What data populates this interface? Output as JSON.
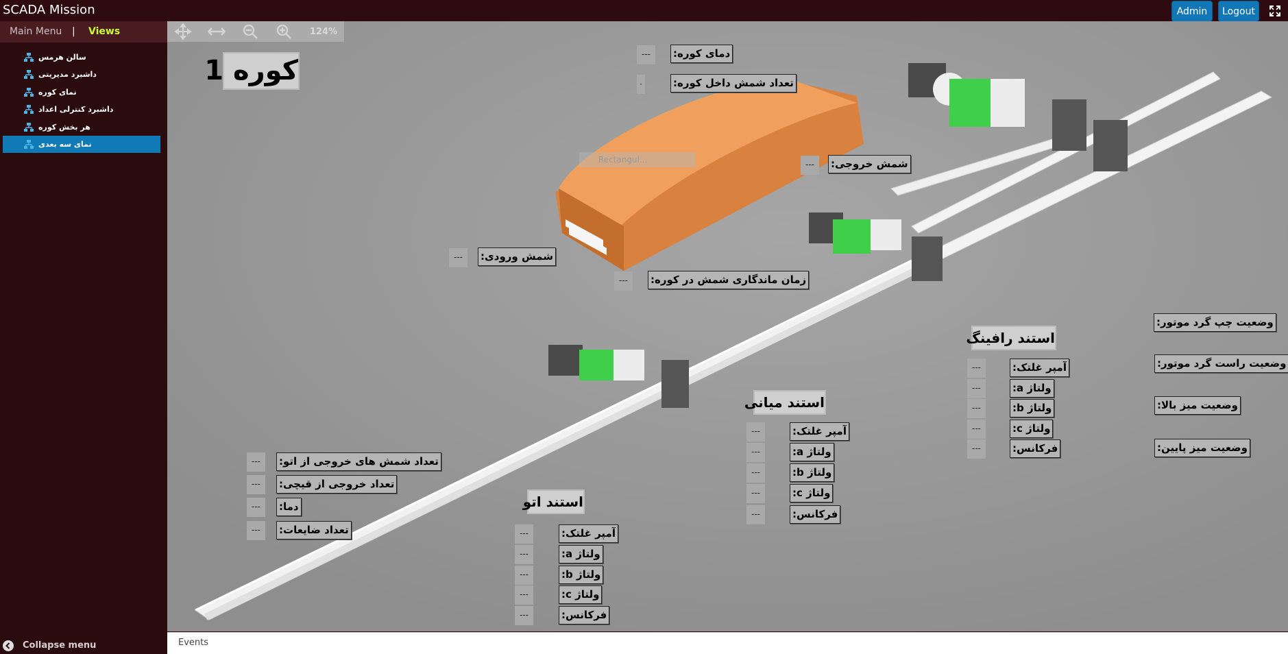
{
  "header": {
    "title": "SCADA Mission",
    "admin": "Admin",
    "logout": "Logout"
  },
  "sidebar": {
    "main_menu": "Main Menu",
    "separator": "|",
    "views": "Views",
    "items": [
      {
        "label": "سالن هرمس"
      },
      {
        "label": "داشبرد مدیریتی"
      },
      {
        "label": "نمای کوره"
      },
      {
        "label": "داشبرد کنترلی اعداد"
      },
      {
        "label": "هر بخش کوره"
      },
      {
        "label": "نمای سه بعدی"
      }
    ],
    "collapse": "Collapse menu"
  },
  "toolbar": {
    "zoom": "124%"
  },
  "events": "Events",
  "scene": {
    "furnace_title": "کوره 1",
    "furnace_temp": {
      "label": "دمای کوره:",
      "value": "---"
    },
    "ingots_inside": {
      "label": "تعداد شمش داخل کوره:",
      "value": "۰"
    },
    "ingot_out": {
      "label": "شمش خروجی:",
      "value": "---"
    },
    "ingot_in": {
      "label": "شمش ورودی:",
      "value": "---"
    },
    "dwell_time": {
      "label": "زمان ماندگاری شمش در کوره:",
      "value": "---"
    },
    "auto_stand": {
      "title": "استند اتو",
      "rows": [
        {
          "label": "آمپر غلتک:",
          "value": "---"
        },
        {
          "label": "ولتاژ a:",
          "value": "---"
        },
        {
          "label": "ولتاژ b:",
          "value": "---"
        },
        {
          "label": "ولتاژ c:",
          "value": "---"
        },
        {
          "label": "فرکانس:",
          "value": "---"
        }
      ]
    },
    "middle_stand": {
      "title": "استند میانی",
      "rows": [
        {
          "label": "آمپر غلتک:",
          "value": "---"
        },
        {
          "label": "ولتاژ a:",
          "value": "---"
        },
        {
          "label": "ولتاژ b:",
          "value": "---"
        },
        {
          "label": "ولتاژ c:",
          "value": "---"
        },
        {
          "label": "فرکانس:",
          "value": "---"
        }
      ]
    },
    "raffing_stand": {
      "title": "استند رافینگ",
      "rows": [
        {
          "label": "آمپر غلتک:",
          "value": "---"
        },
        {
          "label": "ولتاژ a:",
          "value": "---"
        },
        {
          "label": "ولتاژ b:",
          "value": "---"
        },
        {
          "label": "ولتاژ c:",
          "value": "---"
        },
        {
          "label": "فرکانس:",
          "value": "---"
        }
      ]
    },
    "output_stats": [
      {
        "label": "تعداد شمش های خروجی از اتو:",
        "value": "---"
      },
      {
        "label": "تعداد خروجی از قیچی:",
        "value": "---"
      },
      {
        "label": "دما:",
        "value": "---"
      },
      {
        "label": "تعداد ضایعات:",
        "value": "---"
      }
    ],
    "status_labels": [
      {
        "label": "وضعیت چپ گرد موتور:"
      },
      {
        "label": "وضعیت راست گرد موتور:"
      },
      {
        "label": "وضعیت میز بالا:"
      },
      {
        "label": "وضعیت میز پایین:"
      }
    ],
    "ghost_text": "Rectangul..."
  }
}
